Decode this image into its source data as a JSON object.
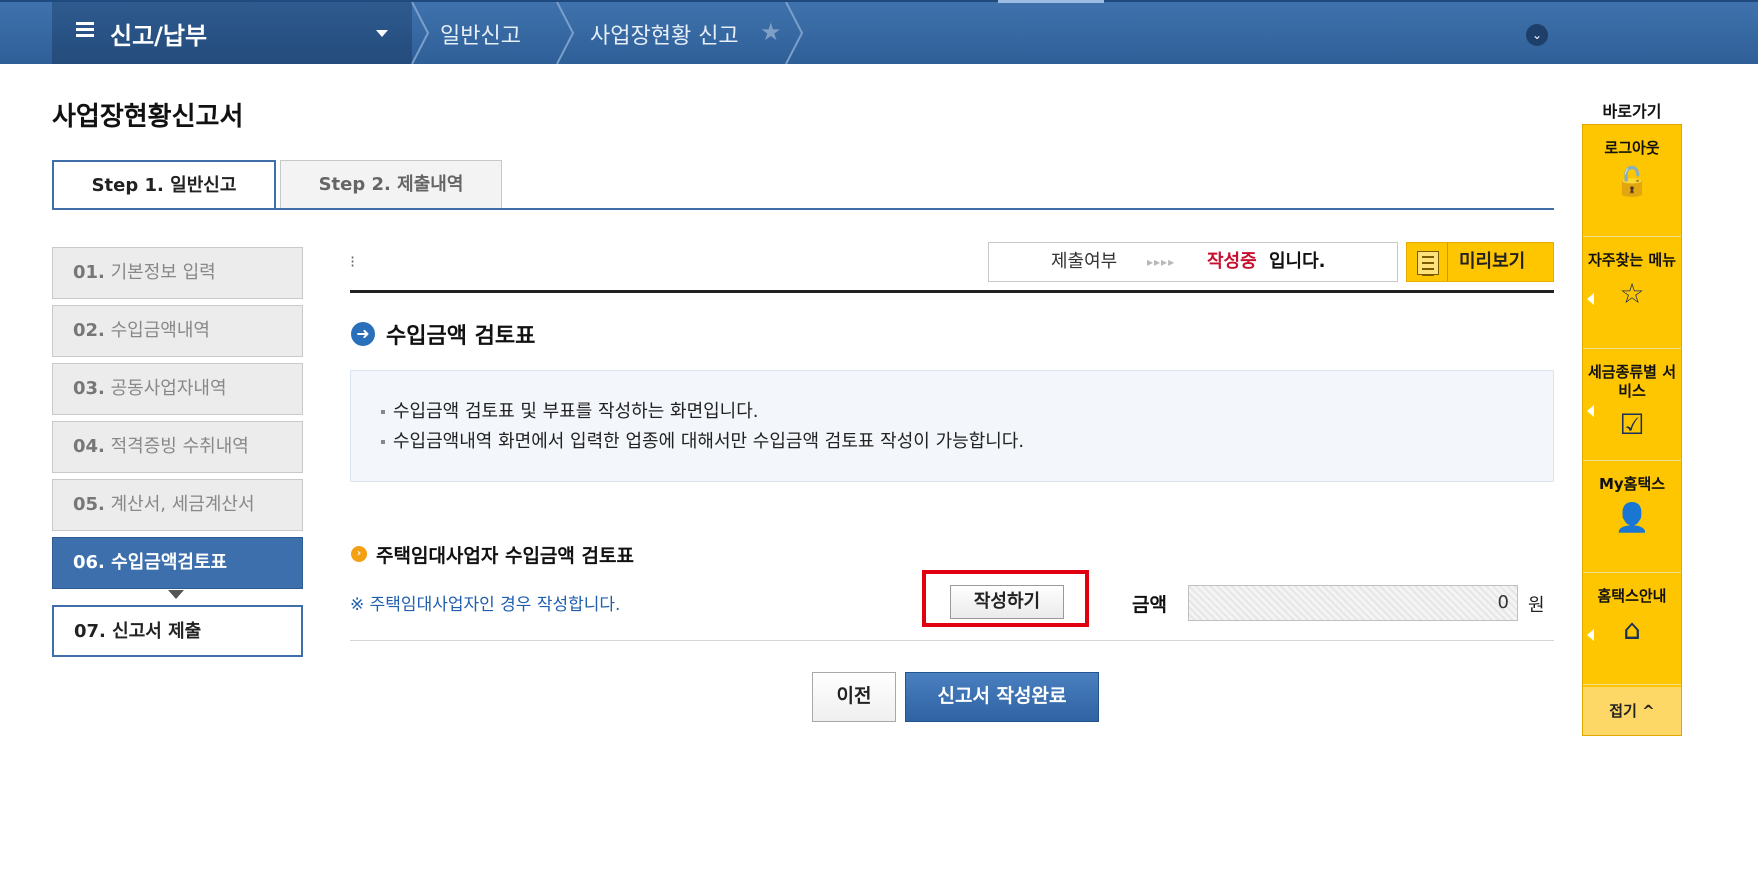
{
  "topnav": {
    "menu_title": "신고/납부",
    "crumb1": "일반신고",
    "crumb2": "사업장현황 신고"
  },
  "page_title": "사업장현황신고서",
  "tabs": [
    {
      "label": "Step 1. 일반신고",
      "active": true
    },
    {
      "label": "Step 2. 제출내역",
      "active": false
    }
  ],
  "steps": [
    {
      "num": "01.",
      "label": "기본정보 입력",
      "state": "done"
    },
    {
      "num": "02.",
      "label": "수입금액내역",
      "state": "done"
    },
    {
      "num": "03.",
      "label": "공동사업자내역",
      "state": "done"
    },
    {
      "num": "04.",
      "label": "적격증빙 수취내역",
      "state": "done"
    },
    {
      "num": "05.",
      "label": "계산서, 세금계산서",
      "state": "done"
    },
    {
      "num": "06.",
      "label": "수입금액검토표",
      "state": "current"
    },
    {
      "num": "07.",
      "label": "신고서 제출",
      "state": "next"
    }
  ],
  "status": {
    "label": "제출여부",
    "arrows": "▸▸▸▸",
    "value": "작성중",
    "suffix": "입니다."
  },
  "preview_label": "미리보기",
  "section": {
    "icon": "arrow-right-circle-icon",
    "title": "수입금액 검토표",
    "info": [
      "수입금액 검토표 및 부표를 작성하는 화면입니다.",
      "수입금액내역 화면에서 입력한 업종에 대해서만 수입금액 검토표 작성이 가능합니다."
    ]
  },
  "subsection": {
    "title": "주택임대사업자 수입금액 검토표",
    "note": "※ 주택임대사업자인 경우 작성합니다.",
    "write_button": "작성하기",
    "amount_label": "금액",
    "amount_value": "0",
    "amount_unit": "원"
  },
  "buttons": {
    "prev": "이전",
    "complete": "신고서 작성완료"
  },
  "quick_menu": {
    "title": "바로가기",
    "items": [
      {
        "label": "로그아웃",
        "icon": "unlock-icon",
        "glyph": "🔓"
      },
      {
        "label": "자주찾는 메뉴",
        "icon": "star-icon",
        "glyph": "☆"
      },
      {
        "label": "세금종류별 서비스",
        "icon": "checkbox-icon",
        "glyph": "☑"
      },
      {
        "label": "My홈택스",
        "icon": "user-icon",
        "glyph": "👤"
      },
      {
        "label": "홈택스안내",
        "icon": "house-guide-icon",
        "glyph": "⌂"
      }
    ],
    "fold_label": "접기 ^"
  },
  "colors": {
    "nav_blue": "#3f72ad",
    "accent_blue": "#3d6fac",
    "quick_yellow": "#fec600",
    "status_red": "#c8102e",
    "highlight_red": "#e0000f"
  }
}
